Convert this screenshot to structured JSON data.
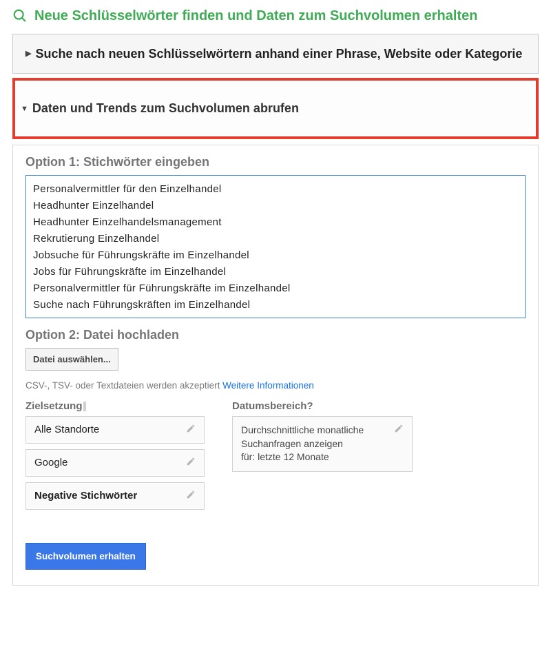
{
  "colors": {
    "accent_green": "#3fab54",
    "highlight_border": "#e33b2e",
    "primary_blue": "#3b78e7",
    "link_blue": "#1a73e8"
  },
  "header": {
    "title": "Neue Schlüsselwörter finden und Daten zum Suchvolumen erhalten"
  },
  "panels": {
    "collapsed": {
      "title": "Suche nach neuen Schlüsselwörtern anhand einer Phrase, Website oder Kategorie"
    },
    "open": {
      "title": "Daten und Trends zum Suchvolumen abrufen"
    }
  },
  "option1": {
    "label": "Option 1: Stichwörter eingeben",
    "keywords": [
      "Personalvermittler für den Einzelhandel",
      "Headhunter Einzelhandel",
      "Headhunter Einzelhandelsmanagement",
      "Rekrutierung Einzelhandel",
      "Jobsuche für Führungskräfte im Einzelhandel",
      "Jobs für Führungskräfte im Einzelhandel",
      "Personalvermittler für Führungskräfte im Einzelhandel",
      "Suche nach Führungskräften im Einzelhandel"
    ]
  },
  "option2": {
    "label": "Option 2: Datei hochladen",
    "button": "Datei auswählen...",
    "hint_text": "CSV-, TSV- oder Textdateien werden akzeptiert ",
    "hint_link": "Weitere Informationen"
  },
  "targeting": {
    "label": "Zielsetzung",
    "items": [
      {
        "label": "Alle Standorte",
        "bold": false
      },
      {
        "label": "Google",
        "bold": false
      },
      {
        "label": "Negative Stichwörter",
        "bold": true
      }
    ]
  },
  "daterange": {
    "label": "Datumsbereich?",
    "text_line1": "Durchschnittliche monatliche",
    "text_line2": "Suchanfragen anzeigen",
    "text_line3": "für: letzte 12 Monate"
  },
  "submit": {
    "label": "Suchvolumen erhalten"
  }
}
